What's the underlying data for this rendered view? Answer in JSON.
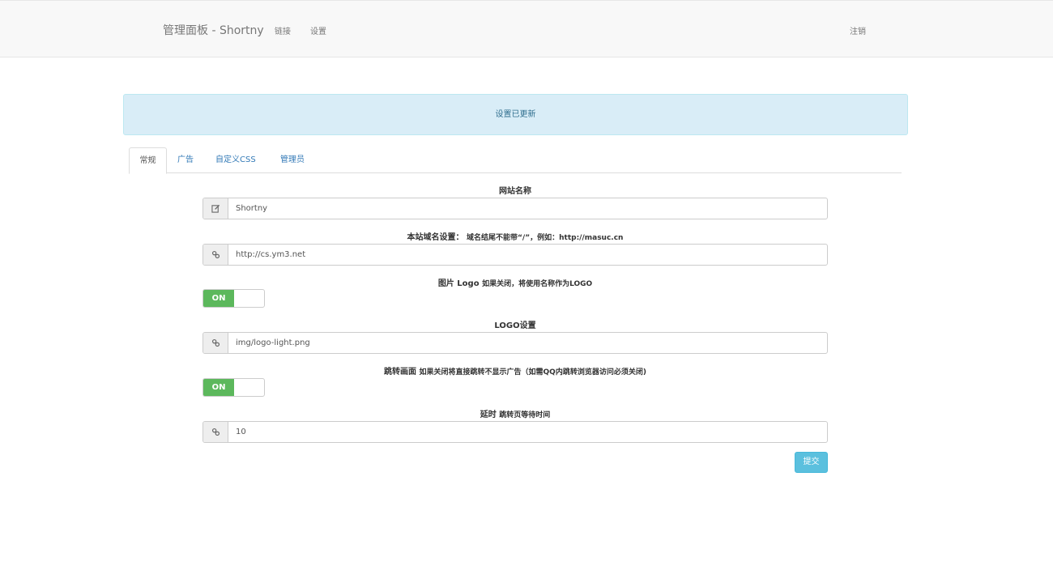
{
  "navbar": {
    "brand": "管理面板 - Shortny",
    "links": [
      "链接",
      "设置"
    ],
    "logout": "注销"
  },
  "alert": {
    "message": "设置已更新"
  },
  "tabs": [
    "常规",
    "广告",
    "自定义CSS",
    "管理员"
  ],
  "form": {
    "site_name": {
      "label": "网站名称",
      "value": "Shortny",
      "icon": "edit-icon"
    },
    "domain": {
      "label": "本站域名设置：",
      "hint": "域名结尾不能带“/”，例如：http://masuc.cn",
      "value": "http://cs.ym3.net",
      "icon": "link-icon"
    },
    "image_logo": {
      "label": "图片 Logo",
      "hint": "如果关闭，将使用名称作为LOGO",
      "toggle": "ON"
    },
    "logo_setting": {
      "label": "LOGO设置",
      "value": "img/logo-light.png",
      "icon": "link-icon"
    },
    "redirect_page": {
      "label": "跳转画面",
      "hint": "如果关闭将直接跳转不显示广告（如需QQ内跳转浏览器访问必须关闭)",
      "toggle": "ON"
    },
    "delay": {
      "label": "延时",
      "hint": "跳转页等待时间",
      "value": "10",
      "icon": "link-icon"
    },
    "submit_label": "提交"
  }
}
